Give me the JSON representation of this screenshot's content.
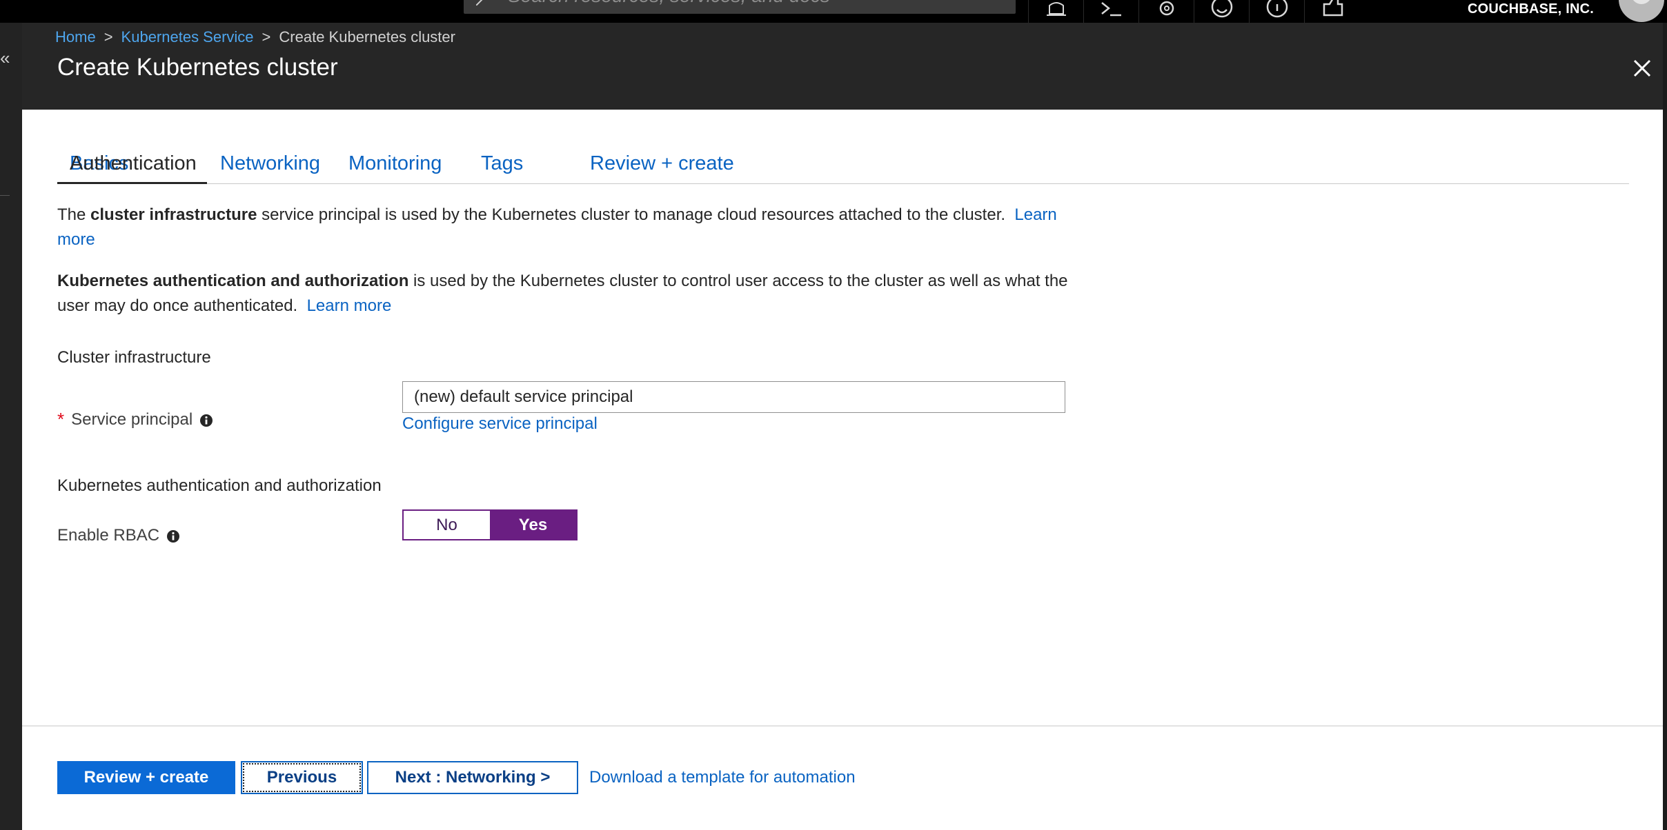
{
  "topbar": {
    "search_placeholder": "Search resources, services, and docs",
    "account_name": "COUCHBASE, INC.",
    "icons": [
      "bell-icon",
      "cloud-shell-icon",
      "gear-icon",
      "smiley-icon",
      "help-icon",
      "feedback-icon"
    ]
  },
  "leftrail": {
    "collapse_glyph": "«"
  },
  "breadcrumb": {
    "home": "Home",
    "separator": ">",
    "service": "Kubernetes Service",
    "current": "Create Kubernetes cluster"
  },
  "blade": {
    "title": "Create Kubernetes cluster"
  },
  "tabs": [
    {
      "label": "Basics",
      "active": false
    },
    {
      "label": "Authentication",
      "active": true
    },
    {
      "label": "Networking",
      "active": false
    },
    {
      "label": "Monitoring",
      "active": false
    },
    {
      "label": "Tags",
      "active": false
    },
    {
      "label": "Review + create",
      "active": false
    }
  ],
  "intro": {
    "p1_prefix": "The ",
    "p1_bold": "cluster infrastructure",
    "p1_rest": " service principal is used by the Kubernetes cluster to manage cloud resources attached to the cluster.",
    "p1_link": "Learn more",
    "p2_bold": "Kubernetes authentication and authorization",
    "p2_rest": " is used by the Kubernetes cluster to control user access to the cluster as well as what the user may do once authenticated.",
    "p2_link": "Learn more"
  },
  "cluster_infra": {
    "section_label": "Cluster infrastructure",
    "required_mark": "*",
    "service_principal_label": "Service principal",
    "service_principal_value": "(new) default service principal",
    "configure_link": "Configure service principal"
  },
  "k8s_auth": {
    "section_label": "Kubernetes authentication and authorization",
    "rbac_label": "Enable RBAC",
    "toggle_no": "No",
    "toggle_yes": "Yes",
    "rbac_enabled": true
  },
  "footer": {
    "review_create": "Review + create",
    "previous": "Previous",
    "next": "Next : Networking >",
    "download_link": "Download a template for automation"
  },
  "colors": {
    "link": "#0a63c2",
    "primary_button": "#0b6ad6",
    "toggle_accent": "#6a1e82",
    "required": "#e00b1c",
    "header_bg": "#262626"
  }
}
